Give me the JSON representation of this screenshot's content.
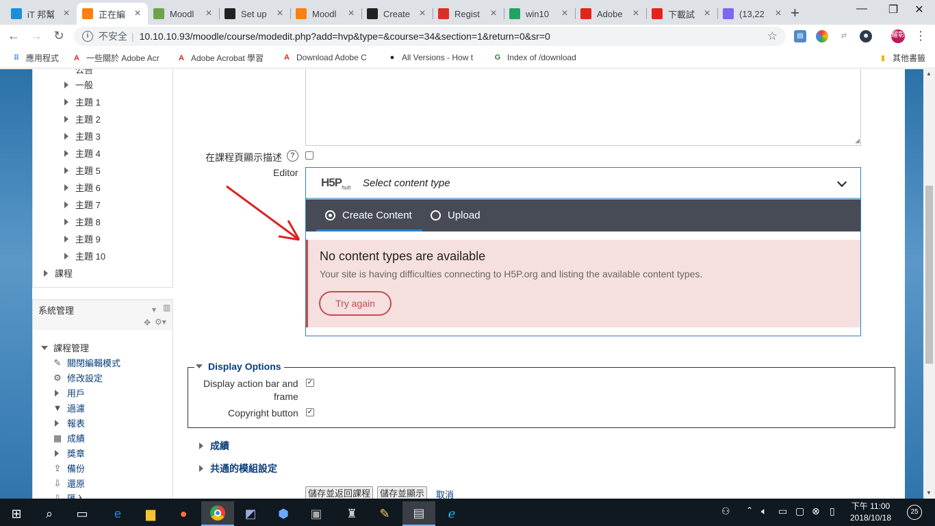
{
  "browser": {
    "tabs": [
      {
        "title": "iT 邦幫",
        "icon": "ithome-icon",
        "color": "#1a8fd8"
      },
      {
        "title": "正在編",
        "icon": "moodle-icon",
        "color": "#f98012",
        "active": true
      },
      {
        "title": "Moodl",
        "icon": "moodle-icon",
        "color": "#6da34d"
      },
      {
        "title": "Set up",
        "icon": "h5p-icon",
        "color": "#222222"
      },
      {
        "title": "Moodl",
        "icon": "moodle-icon",
        "color": "#f98012"
      },
      {
        "title": "Create",
        "icon": "h5p-icon",
        "color": "#222222"
      },
      {
        "title": "Regist",
        "icon": "gmail-icon",
        "color": "#d93025"
      },
      {
        "title": "win10",
        "icon": "drive-icon",
        "color": "#1fa463"
      },
      {
        "title": "Adobe",
        "icon": "adobe-icon",
        "color": "#e1251b"
      },
      {
        "title": "下載試",
        "icon": "adobe-icon",
        "color": "#e1251b"
      },
      {
        "title": "(13,22",
        "icon": "mail-icon",
        "color": "#7b68ee"
      }
    ],
    "new_tab": "+",
    "address": {
      "security_label": "不安全",
      "url": "10.10.10.93/moodle/course/modedit.php?add=hvp&type=&course=34&section=1&return=0&sr=0"
    },
    "profile_label": "耀彰",
    "bookmarks": [
      {
        "label": "應用程式",
        "icon": "apps-icon"
      },
      {
        "label": "一些關於 Adobe Acr",
        "icon": "adobe-icon"
      },
      {
        "label": "Adobe Acrobat 學習",
        "icon": "adobe-icon"
      },
      {
        "label": "Download Adobe C",
        "icon": "adobe-icon"
      },
      {
        "label": "All Versions - How t",
        "icon": "github-icon"
      },
      {
        "label": "Index of /download",
        "icon": "index-icon"
      }
    ],
    "other_bookmarks": "其他書籤"
  },
  "nav": {
    "partial_top": "公告",
    "items": [
      "一般",
      "主題 1",
      "主題 2",
      "主題 3",
      "主題 4",
      "主題 5",
      "主題 6",
      "主題 7",
      "主題 8",
      "主題 9",
      "主題 10"
    ],
    "course_item": "課程"
  },
  "admin": {
    "title": "系統管理",
    "course_admin": "課程管理",
    "items": [
      {
        "label": "關閉編輯模式",
        "icon": "pencil-icon",
        "glyph": "✎"
      },
      {
        "label": "修改設定",
        "icon": "gear-icon",
        "glyph": "⚙"
      },
      {
        "label": "用戶",
        "icon": "caret-icon",
        "glyph": ""
      },
      {
        "label": "過濾",
        "icon": "filter-icon",
        "glyph": "▼"
      },
      {
        "label": "報表",
        "icon": "caret-icon",
        "glyph": ""
      },
      {
        "label": "成績",
        "icon": "table-icon",
        "glyph": "▦"
      },
      {
        "label": "獎章",
        "icon": "caret-icon",
        "glyph": ""
      },
      {
        "label": "備份",
        "icon": "upload-icon",
        "glyph": "⇪"
      },
      {
        "label": "還原",
        "icon": "download-icon",
        "glyph": "⇩"
      },
      {
        "label": "匯入",
        "icon": "download-icon",
        "glyph": "⇩"
      }
    ]
  },
  "form": {
    "show_desc_label": "在課程頁顯示描述",
    "editor_label": "Editor",
    "h5p": {
      "logo": "H5P",
      "logo_sub": "hub",
      "select_label": "Select content type",
      "tab_create": "Create Content",
      "tab_upload": "Upload",
      "error_title": "No content types are available",
      "error_msg": "Your site is having difficulties connecting to H5P.org and listing the available content types.",
      "retry_label": "Try again"
    },
    "display_options": {
      "legend": "Display Options",
      "action_bar_label_1": "Display action bar and",
      "action_bar_label_2": "frame",
      "copyright_label": "Copyright button"
    },
    "grade_section": "成績",
    "common_section": "共通的模組設定",
    "save_return": "儲存並返回課程",
    "save_display": "儲存並顯示",
    "cancel": "取消"
  },
  "taskbar": {
    "time": "下午 11:00",
    "date": "2018/10/18",
    "notifications": "25"
  }
}
